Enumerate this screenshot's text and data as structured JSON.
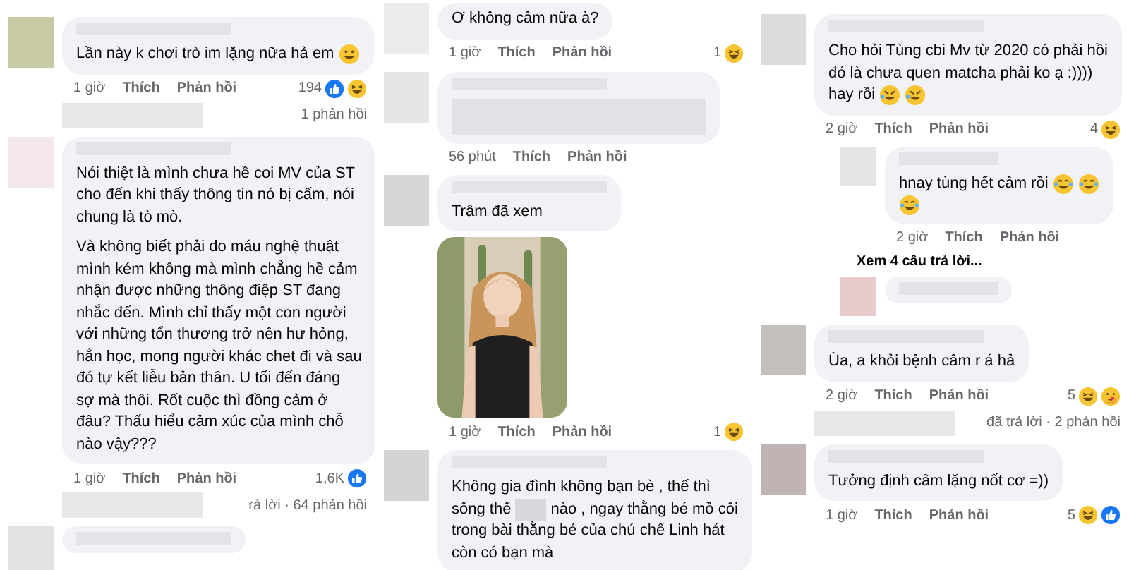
{
  "panels": [
    {
      "items": [
        {
          "kind": "comment",
          "color": "#c8caa6",
          "name_blurred": true,
          "paragraphs": [
            [
              {
                "text": "Lần này k chơi trò im lặng nữa hả em",
                "emoji": [
                  {
                    "kind": "grin"
                  }
                ]
              }
            ]
          ],
          "time": "1 giờ",
          "like": "Thích",
          "reply": "Phản hồi",
          "count": "194",
          "reactions": [
            {
              "kind": "like"
            },
            {
              "kind": "haha"
            }
          ],
          "summary": {
            "blurred": true,
            "text": "1 phản hồi"
          }
        },
        {
          "kind": "comment",
          "color": "#f3e6ec",
          "name_blurred": true,
          "paragraphs": [
            [
              {
                "text": "Nói thiệt là mình chưa hề coi MV của ST"
              },
              {
                "text": "cho đến khi thấy thông tin nó bị cấm, nói"
              },
              {
                "text": "chung là tò mò."
              }
            ],
            [
              {
                "text": "Và không biết phải do máu nghệ thuật"
              },
              {
                "text": "mình kém không mà mình chẳng hề cảm"
              },
              {
                "text": "nhận được những thông điệp ST đang"
              },
              {
                "text": "nhắc đến. Mình chỉ thấy một con người"
              },
              {
                "text": "với những tổn thương trở nên hư hỏng,"
              },
              {
                "text": "hắn học, mong người khác chet đi và sau"
              },
              {
                "text": "đó tự kết liễu bản thân. U tối đến đáng"
              },
              {
                "text": "sợ mà thôi. Rốt cuộc thì đồng cảm ở"
              },
              {
                "text": "đâu? Thấu hiểu cảm xúc của mình chỗ"
              },
              {
                "text": "nào vậy???"
              }
            ]
          ],
          "time": "1 giờ",
          "like": "Thích",
          "reply": "Phản hồi",
          "count": "1,6K",
          "reactions": [
            {
              "kind": "like"
            }
          ],
          "summary": {
            "blurred": true,
            "text": "rả lời · 64 phản hồi"
          }
        },
        {
          "kind": "comment",
          "color": "#e2e2e2",
          "name_blurred": true
        }
      ]
    },
    {
      "items": [
        {
          "kind": "comment",
          "color": "#ececec",
          "paragraphs": [
            [
              {
                "text": "Ơ không câm nữa à?"
              }
            ]
          ],
          "time": "1 giờ",
          "like": "Thích",
          "reply": "Phản hồi",
          "count": "1",
          "reactions": [
            {
              "kind": "haha"
            }
          ]
        },
        {
          "kind": "comment",
          "color": "#e6e6e6",
          "name_blurred": true,
          "body_blurred": true,
          "time": "56 phút",
          "like": "Thích",
          "reply": "Phản hồi"
        },
        {
          "kind": "comment",
          "color": "#d6d6d6",
          "name_blurred": true,
          "paragraphs": [
            [
              {
                "text": "Trâm đã xem"
              }
            ]
          ],
          "photo": {
            "kind": "picture"
          },
          "time": "1 giờ",
          "like": "Thích",
          "reply": "Phản hồi",
          "count": "1",
          "reactions": [
            {
              "kind": "haha"
            }
          ]
        },
        {
          "kind": "comment",
          "color": "#d4d4d4",
          "name_blurred": true,
          "paragraphs": [
            [
              {
                "text": "Không gia đình không bạn bè , thế thì"
              },
              {
                "text": "sống thế",
                "masked": true,
                "rest": "nào , ngay thằng bé mồ côi"
              },
              {
                "text": "trong bài thằng bé của chú chế Linh hát"
              },
              {
                "text": "còn có bạn mà"
              }
            ]
          ]
        }
      ]
    },
    {
      "items": [
        {
          "kind": "comment",
          "color": "#dcdcdc",
          "name_blurred": true,
          "paragraphs": [
            [
              {
                "text": "Cho hỏi Tùng cbi Mv từ 2020 có phải hồi"
              },
              {
                "text": "đó là chưa quen matcha phải ko ạ :))))"
              },
              {
                "text": "hay rồi",
                "emoji": [
                  {
                    "kind": "rofl"
                  },
                  {
                    "kind": "rofl"
                  }
                ]
              }
            ]
          ],
          "time": "2 giờ",
          "like": "Thích",
          "reply": "Phản hồi",
          "count": "4",
          "reactions": [
            {
              "kind": "haha"
            }
          ],
          "children": [
            {
              "kind": "comment",
              "color": "#e4e4e4",
              "name_blurred": true,
              "paragraphs": [
                [
                  {
                    "text": "hnay tùng hết câm rồi",
                    "emoji": [
                      {
                        "kind": "joy"
                      },
                      {
                        "kind": "joy"
                      }
                    ]
                  },
                  {
                    "emoji": [
                      {
                        "kind": "joy"
                      }
                    ]
                  }
                ]
              ],
              "time": "2 giờ",
              "like": "Thích",
              "reply": "Phản hồi"
            },
            {
              "kind": "more",
              "text": "Xem 4 câu trả lời..."
            },
            {
              "kind": "comment",
              "color": "#e8c9cc",
              "name_blurred": true
            }
          ]
        },
        {
          "kind": "comment",
          "color": "#c4c1bd",
          "name_blurred": true,
          "paragraphs": [
            [
              {
                "text": "Ùa, a khỏi bệnh câm r á hả"
              }
            ]
          ],
          "time": "2 giờ",
          "like": "Thích",
          "reply": "Phản hồi",
          "count": "5",
          "reactions": [
            {
              "kind": "haha"
            },
            {
              "kind": "care"
            }
          ],
          "summary": {
            "blurred": true,
            "text": "đã trả lời · 2 phản hồi"
          }
        },
        {
          "kind": "comment",
          "color": "#bfb3b3",
          "name_blurred": true,
          "paragraphs": [
            [
              {
                "text": "Tưởng định câm lặng nốt cơ =))"
              }
            ]
          ],
          "time": "1 giờ",
          "like": "Thích",
          "reply": "Phản hồi",
          "count": "5",
          "reactions": [
            {
              "kind": "haha"
            },
            {
              "kind": "like"
            }
          ]
        }
      ]
    }
  ]
}
